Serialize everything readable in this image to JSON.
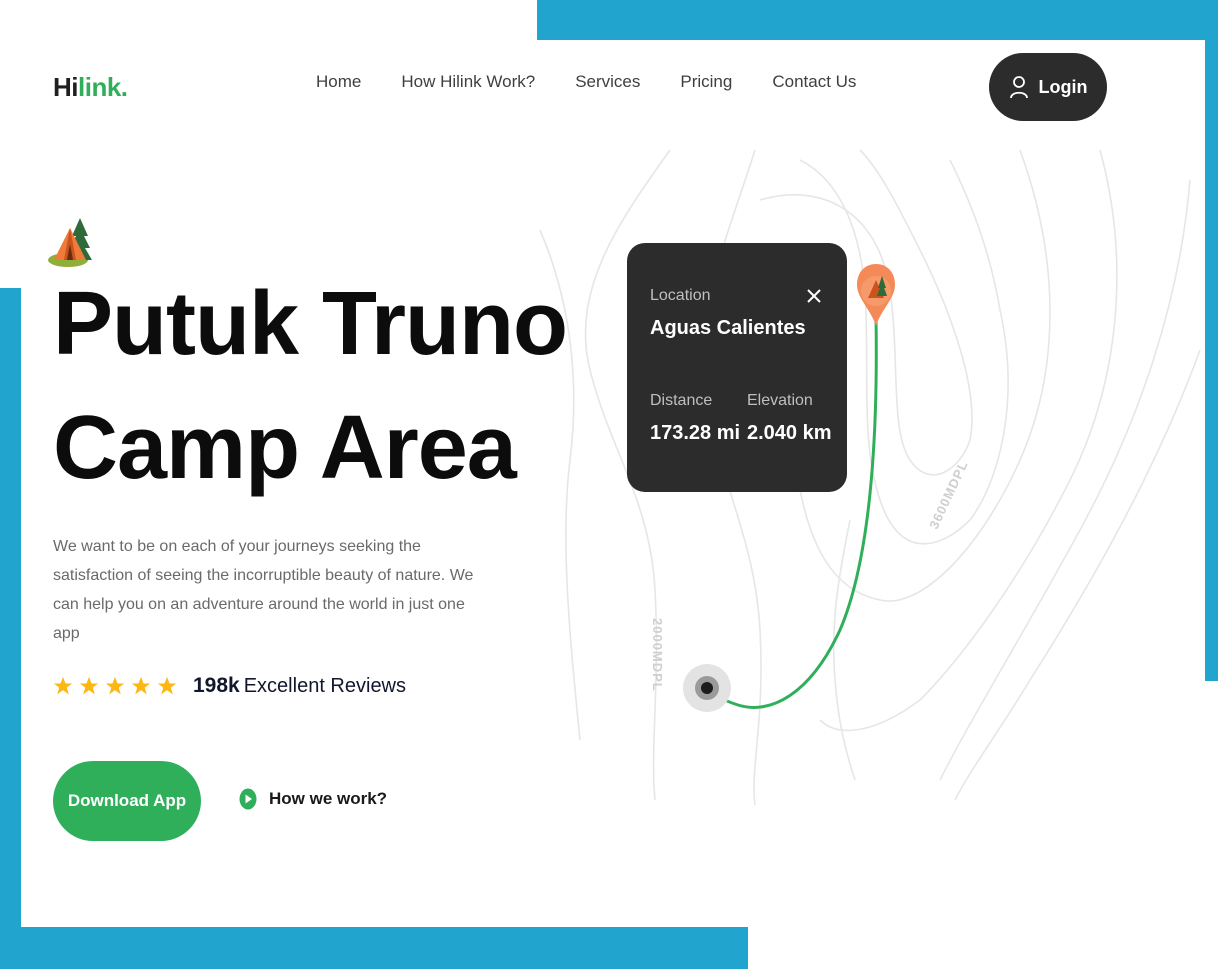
{
  "brand": {
    "logo_hi": "Hi",
    "logo_rest": "link.",
    "color": "#30af5b"
  },
  "nav": {
    "items": [
      "Home",
      "How Hilink Work?",
      "Services",
      "Pricing",
      "Contact Us"
    ]
  },
  "header": {
    "login_label": "Login"
  },
  "hero": {
    "title_line1": "Putuk Truno",
    "title_line2": "Camp Area",
    "description": "We want to be on each of your journeys seeking the satisfaction of seeing the incorruptible beauty of nature. We can help you on an adventure around the world in just one app",
    "rating": {
      "stars": 5,
      "count": "198k",
      "label": "Excellent Reviews"
    },
    "download_label": "Download App",
    "how_label": "How we work?"
  },
  "map": {
    "contour_label_1": "3600MDPL",
    "contour_label_2": "2000MDPL",
    "card": {
      "location_label": "Location",
      "location_value": "Aguas Calientes",
      "distance_label": "Distance",
      "distance_value": "173.28 mi",
      "elevation_label": "Elevation",
      "elevation_value": "2.040 km"
    }
  },
  "colors": {
    "accent_blue": "#21a5cf",
    "dark": "#2b2c2b",
    "green": "#30af5b",
    "star": "#fcb713",
    "pin": "#f58a59"
  }
}
